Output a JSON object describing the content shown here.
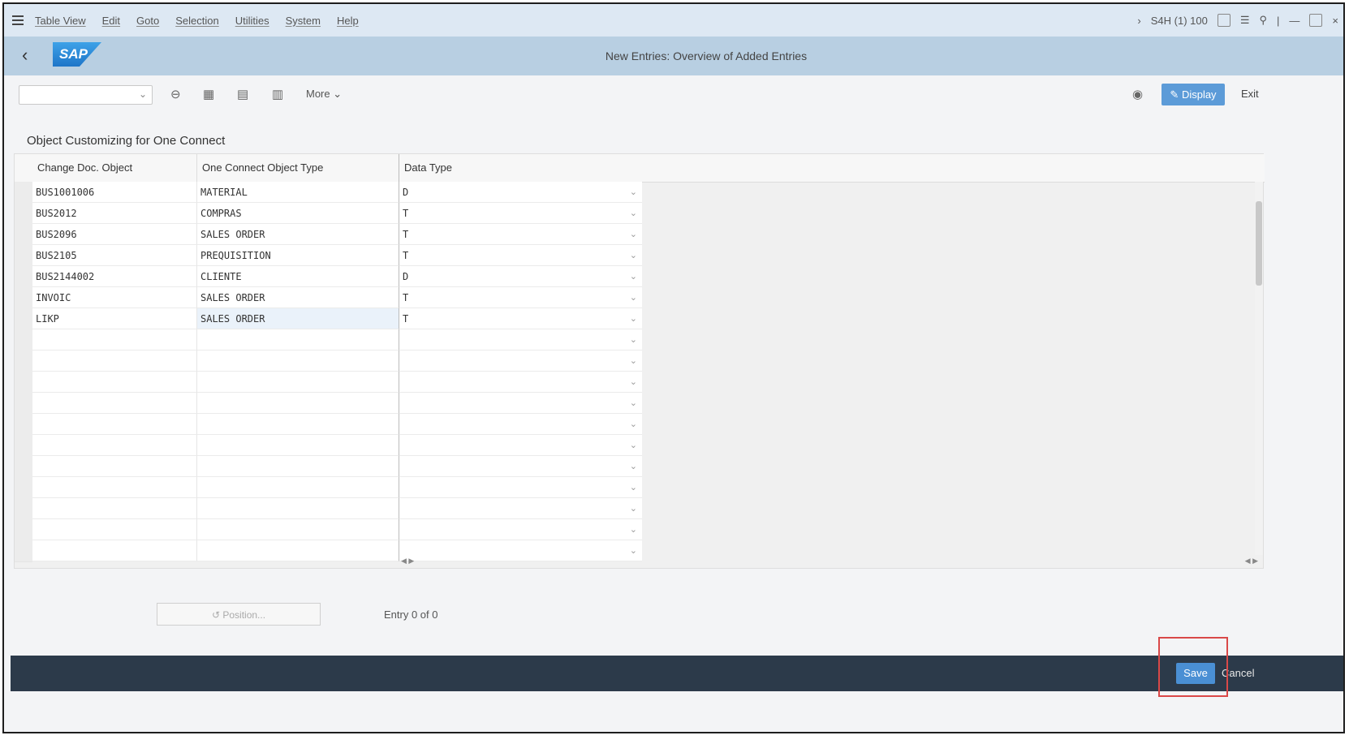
{
  "menu": {
    "items": [
      "Table View",
      "Edit",
      "Goto",
      "Selection",
      "Utilities",
      "System",
      "Help"
    ],
    "session": "S4H (1) 100"
  },
  "header": {
    "title": "New Entries: Overview of Added Entries",
    "logo": "SAP"
  },
  "toolbar": {
    "more_label": "More",
    "display_label": "Display",
    "exit_label": "Exit"
  },
  "section": {
    "title": "Object Customizing for One Connect"
  },
  "table": {
    "columns": [
      "Change Doc. Object",
      "One Connect Object Type",
      "Data Type"
    ],
    "rows": [
      {
        "obj": "BUS1001006",
        "type": "MATERIAL",
        "data": "D"
      },
      {
        "obj": "BUS2012",
        "type": "COMPRAS",
        "data": "T"
      },
      {
        "obj": "BUS2096",
        "type": "SALES ORDER",
        "data": "T"
      },
      {
        "obj": "BUS2105",
        "type": "PREQUISITION",
        "data": "T"
      },
      {
        "obj": "BUS2144002",
        "type": "CLIENTE",
        "data": "D"
      },
      {
        "obj": "INVOIC",
        "type": "SALES ORDER",
        "data": "T"
      },
      {
        "obj": "LIKP",
        "type": "SALES ORDER",
        "data": "T"
      },
      {
        "obj": "",
        "type": "",
        "data": ""
      },
      {
        "obj": "",
        "type": "",
        "data": ""
      },
      {
        "obj": "",
        "type": "",
        "data": ""
      },
      {
        "obj": "",
        "type": "",
        "data": ""
      },
      {
        "obj": "",
        "type": "",
        "data": ""
      },
      {
        "obj": "",
        "type": "",
        "data": ""
      },
      {
        "obj": "",
        "type": "",
        "data": ""
      },
      {
        "obj": "",
        "type": "",
        "data": ""
      },
      {
        "obj": "",
        "type": "",
        "data": ""
      },
      {
        "obj": "",
        "type": "",
        "data": ""
      },
      {
        "obj": "",
        "type": "",
        "data": ""
      }
    ]
  },
  "footer": {
    "position_label": "Position...",
    "entry_text": "Entry 0 of 0"
  },
  "bottombar": {
    "save_label": "Save",
    "cancel_label": "Cancel"
  },
  "colors": {
    "menubar": "#dde8f3",
    "titlebar": "#b8cfe2",
    "accent": "#4a8fd4",
    "bottombar": "#2c3a4a",
    "highlight": "#d94848"
  }
}
